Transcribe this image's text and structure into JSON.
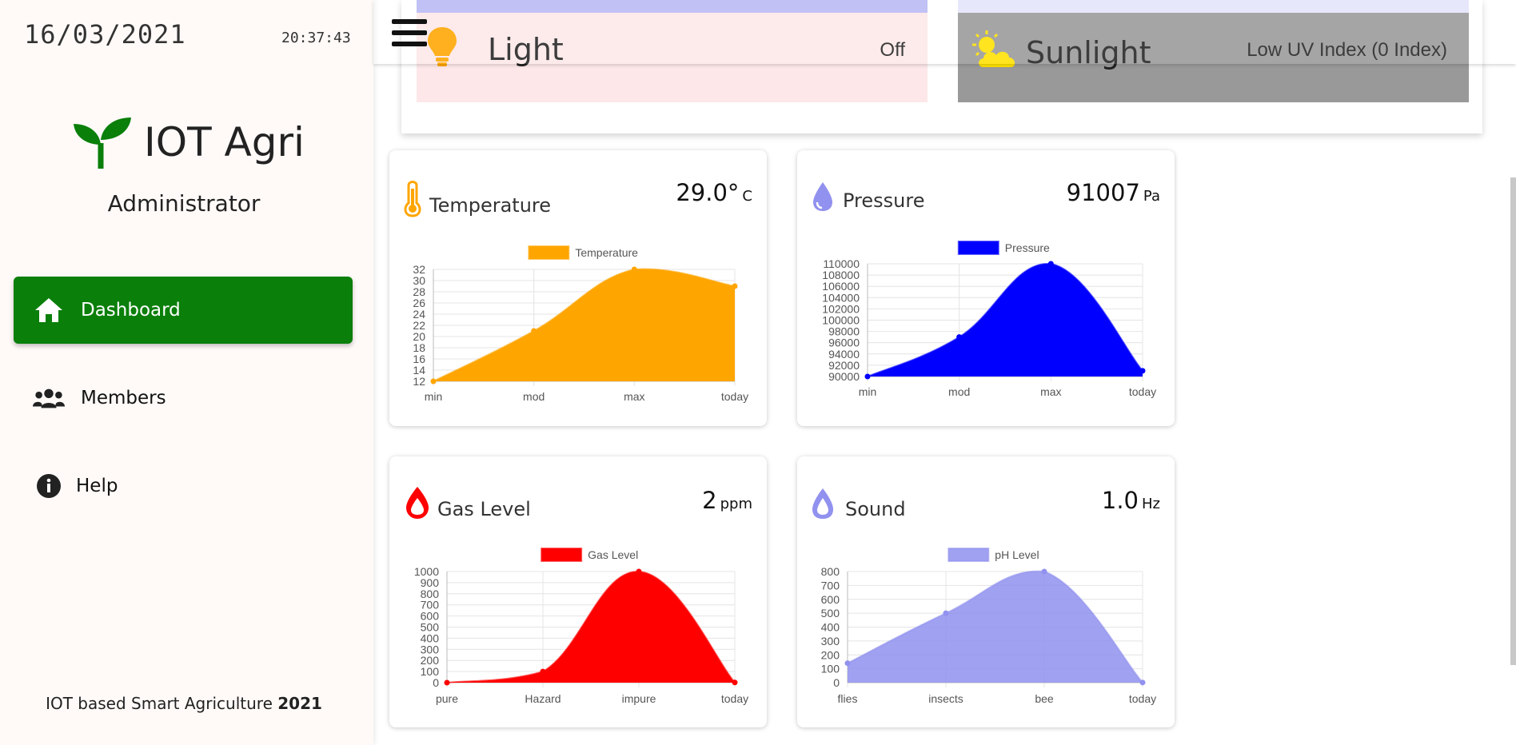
{
  "sidebar": {
    "date": "16/03/2021",
    "time": "20:37:43",
    "brand_title": "IOT Agri",
    "role": "Administrator",
    "nav": [
      {
        "label": "Dashboard",
        "icon": "home-icon",
        "active": true
      },
      {
        "label": "Members",
        "icon": "users-icon",
        "active": false
      },
      {
        "label": "Help",
        "icon": "info-icon",
        "active": false
      }
    ],
    "footer_text": "IOT based Smart Agriculture",
    "footer_year": "2021"
  },
  "top": {
    "light": {
      "title": "Light",
      "value": "Off",
      "icon": "lightbulb-icon"
    },
    "sunlight": {
      "title": "Sunlight",
      "value": "Low UV Index (0 Index)",
      "icon": "sun-cloud-icon"
    }
  },
  "cards": {
    "temperature": {
      "title": "Temperature",
      "value": "29.0°",
      "unit": "C",
      "icon": "thermometer-icon"
    },
    "pressure": {
      "title": "Pressure",
      "value": "91007",
      "unit": "Pa",
      "icon": "drop-icon"
    },
    "gas": {
      "title": "Gas Level",
      "value": "2",
      "unit": "ppm",
      "icon": "fire-drop-icon"
    },
    "sound": {
      "title": "Sound",
      "value": "1.0",
      "unit": "Hz",
      "icon": "drop-icon"
    }
  },
  "colors": {
    "accent": "#0a7f0a",
    "temperature": "#ffa500",
    "pressure": "#0000ff",
    "gas": "#ff0000",
    "sound": "#9191ef"
  },
  "chart_data": [
    {
      "id": "temp",
      "type": "area",
      "legend": "Temperature",
      "color": "#ffa500",
      "categories": [
        "min",
        "mod",
        "max",
        "today"
      ],
      "values": [
        12,
        21,
        32,
        29
      ],
      "ylim": [
        12,
        32
      ],
      "yticks": [
        12,
        14,
        16,
        18,
        20,
        22,
        24,
        26,
        28,
        30,
        32
      ]
    },
    {
      "id": "press",
      "type": "area",
      "legend": "Pressure",
      "color": "#0000ff",
      "categories": [
        "min",
        "mod",
        "max",
        "today"
      ],
      "values": [
        90000,
        97000,
        110000,
        91007
      ],
      "ylim": [
        90000,
        110000
      ],
      "yticks": [
        90000,
        92000,
        94000,
        96000,
        98000,
        100000,
        102000,
        104000,
        106000,
        108000,
        110000
      ]
    },
    {
      "id": "gas",
      "type": "area",
      "legend": "Gas Level",
      "color": "#ff0000",
      "categories": [
        "pure",
        "Hazard",
        "impure",
        "today"
      ],
      "values": [
        0,
        100,
        1000,
        2
      ],
      "ylim": [
        0,
        1000
      ],
      "yticks": [
        0,
        100,
        200,
        300,
        400,
        500,
        600,
        700,
        800,
        900,
        1000
      ]
    },
    {
      "id": "sound",
      "type": "area",
      "legend": "pH Level",
      "color": "#9191ef",
      "categories": [
        "flies",
        "insects",
        "bee",
        "today"
      ],
      "values": [
        140,
        500,
        800,
        1
      ],
      "ylim": [
        0,
        800
      ],
      "yticks": [
        0,
        100,
        200,
        300,
        400,
        500,
        600,
        700,
        800
      ]
    }
  ]
}
